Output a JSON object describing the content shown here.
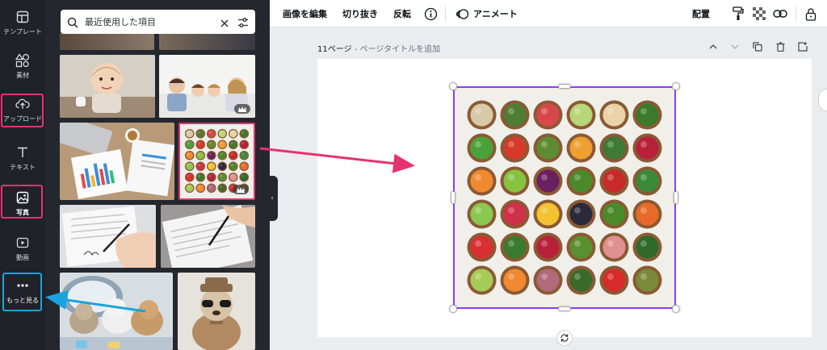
{
  "rail": {
    "items": [
      {
        "label": "テンプレート",
        "icon": "template-icon"
      },
      {
        "label": "素材",
        "icon": "elements-icon"
      },
      {
        "label": "アップロード",
        "icon": "upload-cloud-icon"
      },
      {
        "label": "テキスト",
        "icon": "text-icon"
      },
      {
        "label": "写真",
        "icon": "photo-icon"
      },
      {
        "label": "動画",
        "icon": "video-icon"
      },
      {
        "label": "もっと見る",
        "icon": "more-dots-icon"
      }
    ],
    "highlight_pink": "#e5336d",
    "highlight_blue": "#1aa3dd"
  },
  "panel": {
    "search_value": "最近使用した項目"
  },
  "toolbar": {
    "edit_image": "画像を編集",
    "crop": "切り抜き",
    "flip": "反転",
    "animate": "アニメート",
    "position": "配置"
  },
  "page": {
    "title": "11ページ",
    "subtitle": " - ページタイトルを追加"
  },
  "colors": {
    "selection": "#8b3dff",
    "rail_bg": "#1f2229",
    "panel_bg": "#24272e",
    "arrow_pink": "#e5336d",
    "arrow_blue": "#1aa3dd"
  }
}
